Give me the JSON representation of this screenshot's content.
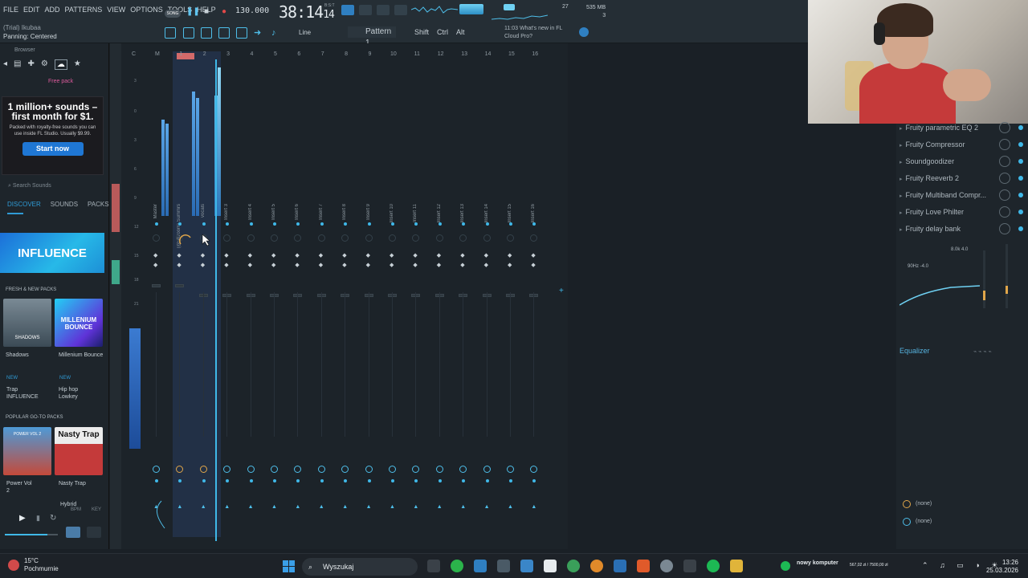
{
  "menu": [
    "FILE",
    "EDIT",
    "ADD",
    "PATTERNS",
    "VIEW",
    "OPTIONS",
    "TOOLS",
    "HELP"
  ],
  "status": {
    "user": "(Trial) Ikubaa",
    "hint": "Panning: Centered"
  },
  "transport": {
    "song_mode": "SONG",
    "tempo": "130.000",
    "time": "38:14",
    "time_frac": "14",
    "time_small": "B:S:T"
  },
  "toolbar": {
    "line_mode": "Line",
    "pattern": "Pattern 1",
    "shift": "Shift",
    "ctrl": "Ctrl",
    "alt": "Alt"
  },
  "cpu": {
    "value": "27",
    "memory": "535 MB",
    "polyphony": "3"
  },
  "news": {
    "time": "11:03",
    "line1": "What's new in FL",
    "line2": "Cloud Pro?"
  },
  "browser": {
    "title": "Browser",
    "ad_title": "1 million+ sounds – first month for $1.",
    "ad_sub": "Packed with royalty-free sounds you can use inside FL Studio. Usually $9.99.",
    "ad_button": "Start now",
    "search_placeholder": "Search Sounds",
    "tabs": [
      "DISCOVER",
      "SOUNDS",
      "PACKS"
    ],
    "banner": "INFLUENCE",
    "fresh_title": "FRESH & NEW PACKS",
    "popular_title": "POPULAR GO-TO PACKS",
    "packs": [
      {
        "name": "Shadows",
        "tag": "NEW",
        "genre": "Trap",
        "artist": "INFLUENCE",
        "art": "SHADOWS"
      },
      {
        "name": "Millenium Bounce",
        "tag": "NEW",
        "genre": "Hip hop",
        "artist": "Lowkey",
        "art": "MILLENIUM BOUNCE"
      },
      {
        "name": "Power Vol 2",
        "tag": "",
        "genre": "",
        "artist": "",
        "art": "POWER VOL 2"
      },
      {
        "name": "Nasty Trap",
        "tag": "",
        "genre": "Hybrid",
        "artist": "",
        "art": "Nasty Trap"
      }
    ],
    "bpm_label": "BPM",
    "key_label": "KEY"
  },
  "mixer": {
    "numbers": [
      "C",
      "M",
      "1",
      "2",
      "3",
      "4",
      "5",
      "6",
      "7",
      "8",
      "9",
      "10",
      "11",
      "12",
      "13",
      "14",
      "15",
      "16"
    ],
    "tracks": [
      "Master",
      "(@shzoom) Summrs",
      "vocals",
      "Insert 3",
      "Insert 4",
      "Insert 5",
      "Insert 6",
      "Insert 7",
      "Insert 8",
      "Insert 9",
      "Insert 10",
      "Insert 11",
      "Insert 12",
      "Insert 13",
      "Insert 14",
      "Insert 15",
      "Insert 16"
    ],
    "db_labels": [
      "3",
      "0",
      "3",
      "6",
      "9",
      "12",
      "15",
      "18",
      "21"
    ]
  },
  "effects": {
    "slots": [
      "Fruity parametric EQ 2",
      "Fruity Compressor",
      "Soundgoodizer",
      "Fruity Reeverb 2",
      "Fruity Multiband Compr...",
      "Fruity Love Philter",
      "Fruity delay bank"
    ],
    "eq_top": "8.0k 4.0",
    "eq_left": "90Hz -4.0",
    "eq_label": "Equalizer",
    "route_in": "(none)",
    "route_out": "(none)"
  },
  "taskbar": {
    "temperature": "15°C",
    "weather": "Pochmurnie",
    "search": "Wyszukaj",
    "stock_title": "nowy komputer",
    "stock_value": "567,02 zł / 7500,00 zł",
    "time": "13:26",
    "date": "25.03.2026"
  },
  "colors": {
    "accent": "#3fb8e8",
    "selected_track": "#223046",
    "ad_button": "#1f77d4",
    "record": "#e04848",
    "webcam_shirt": "#c53a3a"
  },
  "icons": [
    "play-icon",
    "stop-icon",
    "record-icon",
    "search-icon",
    "cloud-icon",
    "star-icon",
    "windows-icon",
    "folder-icon"
  ]
}
